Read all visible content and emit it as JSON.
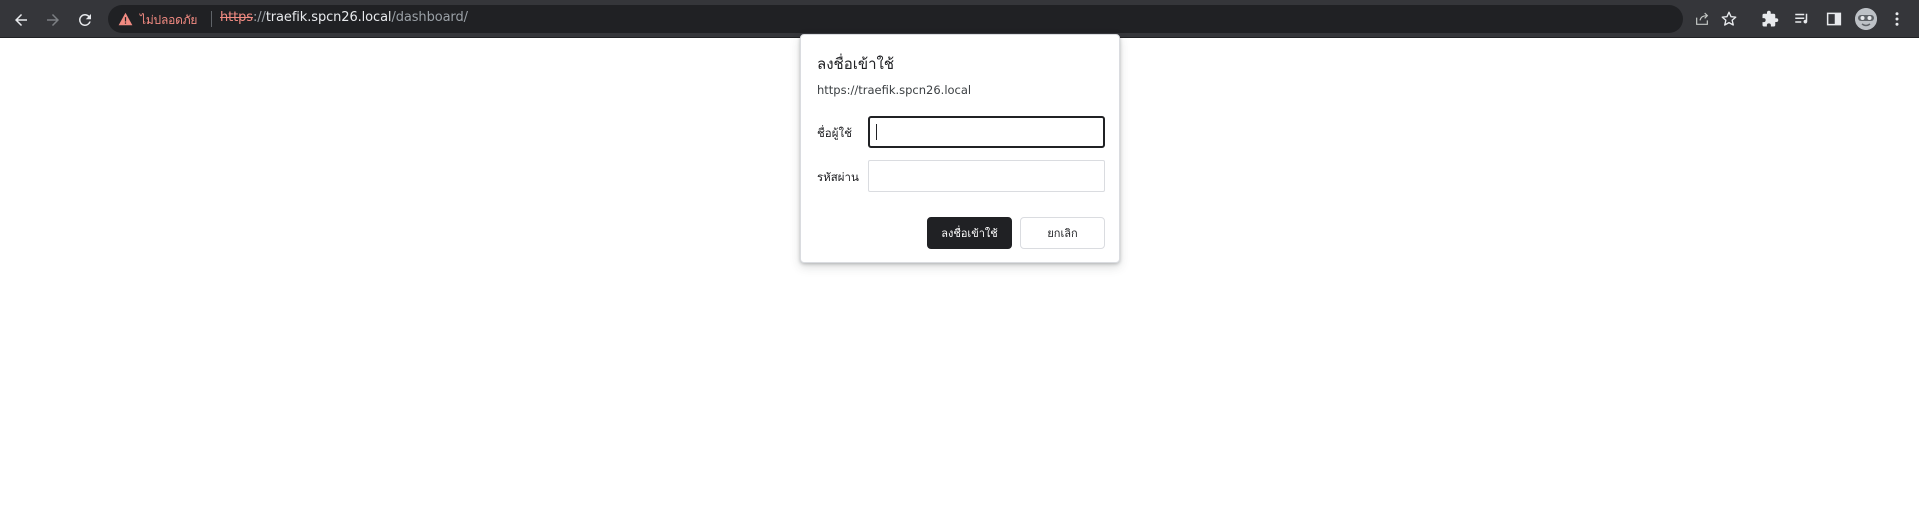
{
  "browser": {
    "security_label": "ไม่ปลอดภัย",
    "url": {
      "scheme": "https",
      "separator": "://",
      "host": "traefik.spcn26.local",
      "path": "/dashboard/"
    },
    "icons": {
      "back": "back-arrow-icon",
      "forward": "forward-arrow-icon",
      "reload": "reload-icon",
      "warning": "warning-triangle-icon",
      "share": "share-icon",
      "bookmark": "star-icon",
      "extensions": "puzzle-icon",
      "reading_list": "reading-list-icon",
      "side_panel": "side-panel-icon",
      "profile": "avatar",
      "menu": "kebab-menu-icon"
    },
    "colors": {
      "toolbar": "#35363a",
      "omnibox": "#202124",
      "warning": "#f28b82"
    }
  },
  "auth_dialog": {
    "title": "ลงชื่อเข้าใช้",
    "origin": "https://traefik.spcn26.local",
    "username_label": "ชื่อผู้ใช้",
    "username_value": "",
    "password_label": "รหัสผ่าน",
    "password_value": "",
    "sign_in_label": "ลงชื่อเข้าใช้",
    "cancel_label": "ยกเลิก"
  }
}
